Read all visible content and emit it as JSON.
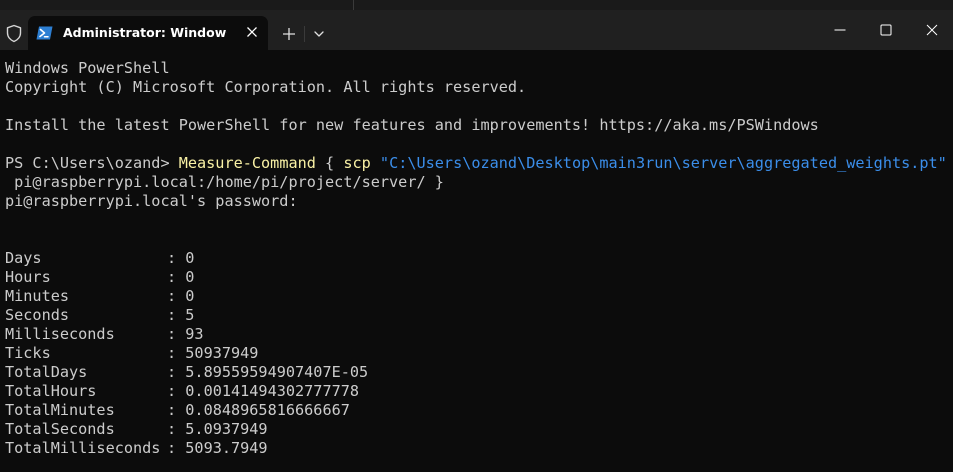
{
  "window": {
    "tab_title": "Administrator: Windows PowerShell",
    "colors": {
      "titlebar": "#202020",
      "terminal_bg": "#0c0c0c",
      "text": "#cccccc",
      "command": "#f9f1a5",
      "string": "#3b8eea"
    },
    "icons": {
      "shield": "shield-icon",
      "tab": "powershell-icon",
      "close_tab": "close-icon",
      "new_tab": "plus-icon",
      "dropdown": "chevron-down-icon",
      "minimize": "minimize-icon",
      "maximize": "maximize-icon",
      "close_window": "close-icon"
    }
  },
  "terminal": {
    "banner_1": "Windows PowerShell",
    "banner_2": "Copyright (C) Microsoft Corporation. All rights reserved.",
    "install_msg": "Install the latest PowerShell for new features and improvements! https://aka.ms/PSWindows",
    "prompt": "PS C:\\Users\\ozand> ",
    "command": "Measure-Command",
    "brace_open": " { ",
    "subcommand": "scp",
    "space": " ",
    "path_string": "\"C:\\Users\\ozand\\Desktop\\main3run\\server\\aggregated_weights.pt\"",
    "continuation": " pi@raspberrypi.local:/home/pi/project/server/ }",
    "password_prompt": "pi@raspberrypi.local's password:",
    "results": [
      {
        "label": "Days",
        "value": ": 0"
      },
      {
        "label": "Hours",
        "value": ": 0"
      },
      {
        "label": "Minutes",
        "value": ": 0"
      },
      {
        "label": "Seconds",
        "value": ": 5"
      },
      {
        "label": "Milliseconds",
        "value": ": 93"
      },
      {
        "label": "Ticks",
        "value": ": 50937949"
      },
      {
        "label": "TotalDays",
        "value": ": 5.89559594907407E-05"
      },
      {
        "label": "TotalHours",
        "value": ": 0.00141494302777778"
      },
      {
        "label": "TotalMinutes",
        "value": ": 0.0848965816666667"
      },
      {
        "label": "TotalSeconds",
        "value": ": 5.0937949"
      },
      {
        "label": "TotalMilliseconds",
        "value": ": 5093.7949"
      }
    ]
  }
}
